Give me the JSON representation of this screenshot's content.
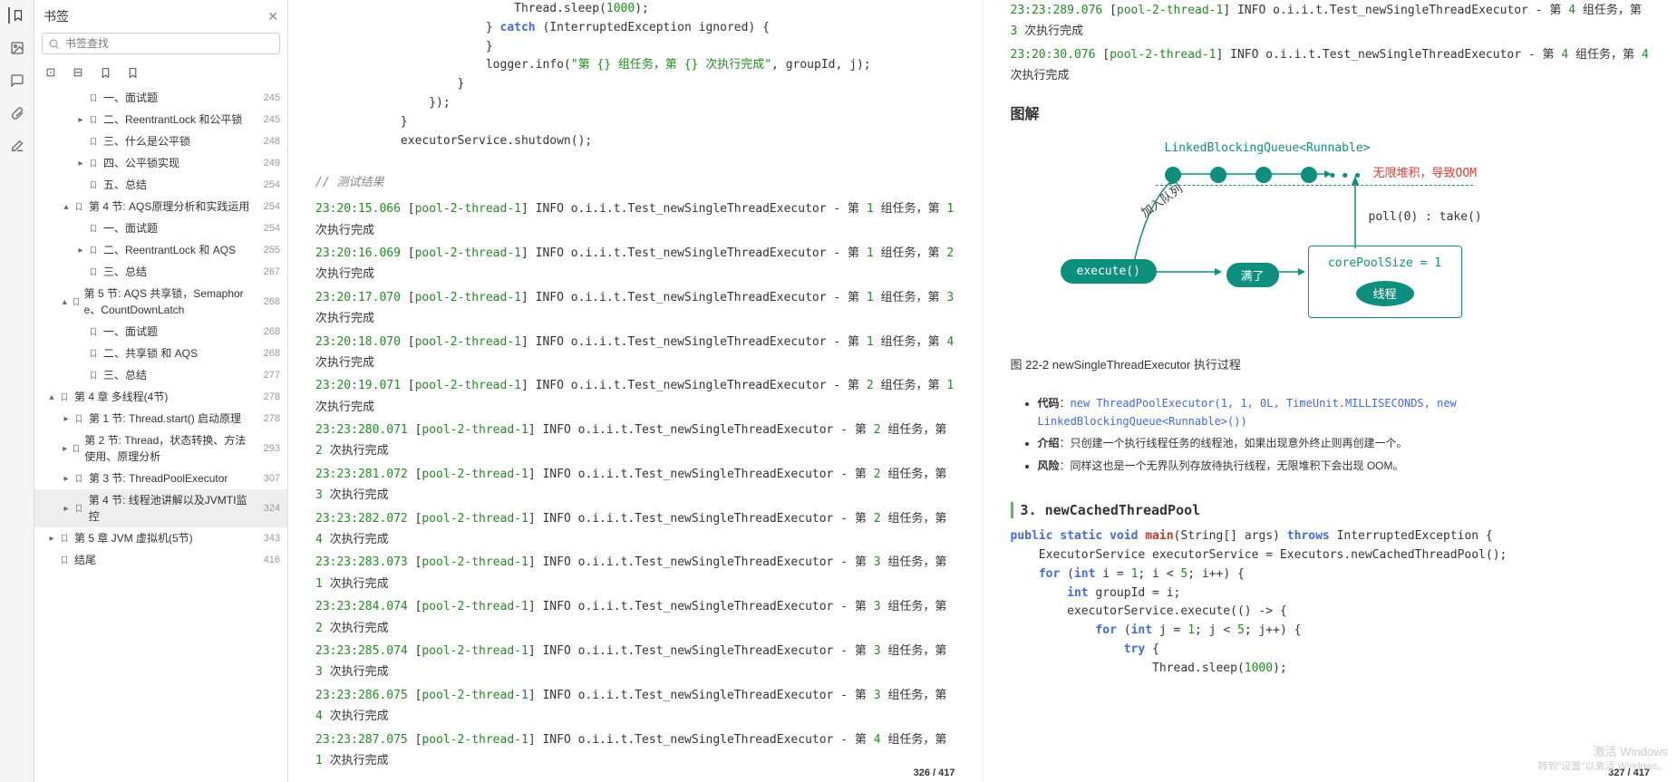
{
  "sidebar": {
    "title": "书签",
    "search_placeholder": "书签查找",
    "items": [
      {
        "arr": "",
        "ind": 2,
        "label": "一、面试题",
        "page": "245"
      },
      {
        "arr": "▸",
        "ind": 2,
        "label": "二、ReentrantLock 和公平锁",
        "page": "245"
      },
      {
        "arr": "",
        "ind": 2,
        "label": "三、什么是公平锁",
        "page": "248"
      },
      {
        "arr": "▸",
        "ind": 2,
        "label": "四、公平锁实现",
        "page": "249"
      },
      {
        "arr": "",
        "ind": 2,
        "label": "五、总结",
        "page": "254"
      },
      {
        "arr": "▴",
        "ind": 1,
        "label": "第 4 节: AQS原理分析和实践运用",
        "page": "254"
      },
      {
        "arr": "",
        "ind": 2,
        "label": "一、面试题",
        "page": "254"
      },
      {
        "arr": "▸",
        "ind": 2,
        "label": "二、ReentrantLock 和 AQS",
        "page": "255"
      },
      {
        "arr": "",
        "ind": 2,
        "label": "三、总结",
        "page": "267"
      },
      {
        "arr": "▴",
        "ind": 1,
        "label": "第 5 节: AQS 共享锁，Semaphore、CountDownLatch",
        "page": "268"
      },
      {
        "arr": "",
        "ind": 2,
        "label": "一、面试题",
        "page": "268"
      },
      {
        "arr": "",
        "ind": 2,
        "label": "二、共享锁 和 AQS",
        "page": "268"
      },
      {
        "arr": "",
        "ind": 2,
        "label": "三、总结",
        "page": "277"
      },
      {
        "arr": "▴",
        "ind": 0,
        "label": "第 4 章 多线程(4节)",
        "page": "278"
      },
      {
        "arr": "▸",
        "ind": 1,
        "label": "第 1 节: Thread.start() 启动原理",
        "page": "278"
      },
      {
        "arr": "▸",
        "ind": 1,
        "label": "第 2 节: Thread，状态转换、方法使用、原理分析",
        "page": "293"
      },
      {
        "arr": "▸",
        "ind": 1,
        "label": "第 3 节: ThreadPoolExecutor",
        "page": "307"
      },
      {
        "arr": "▸",
        "ind": 1,
        "label": "第 4 节: 线程池讲解以及JVMTI监控",
        "page": "324",
        "sel": true
      },
      {
        "arr": "▸",
        "ind": 0,
        "label": "第 5 章 JVM 虚拟机(5节)",
        "page": "343"
      },
      {
        "arr": "",
        "ind": 0,
        "label": "结尾",
        "page": "416"
      }
    ]
  },
  "left_page": {
    "code": [
      "                Thread.sleep(1000);",
      "            } catch (InterruptedException ignored) {",
      "            }",
      "            logger.info(\"第 {} 组任务，第 {} 次执行完成\", groupId, j);",
      "        }",
      "    });",
      "}",
      "executorService.shutdown();"
    ],
    "comment": "// 测试结果",
    "logs": [
      {
        "ts": "23:20:15.066",
        "th": "pool-2-thread-1",
        "g": "1",
        "j": "1"
      },
      {
        "ts": "23:20:16.069",
        "th": "pool-2-thread-1",
        "g": "1",
        "j": "2"
      },
      {
        "ts": "23:20:17.070",
        "th": "pool-2-thread-1",
        "g": "1",
        "j": "3"
      },
      {
        "ts": "23:20:18.070",
        "th": "pool-2-thread-1",
        "g": "1",
        "j": "4"
      },
      {
        "ts": "23:20:19.071",
        "th": "pool-2-thread-1",
        "g": "2",
        "j": "1"
      },
      {
        "ts": "23:23:280.071",
        "th": "pool-2-thread-1",
        "g": "2",
        "j": "2"
      },
      {
        "ts": "23:23:281.072",
        "th": "pool-2-thread-1",
        "g": "2",
        "j": "3"
      },
      {
        "ts": "23:23:282.072",
        "th": "pool-2-thread-1",
        "g": "2",
        "j": "4"
      },
      {
        "ts": "23:23:283.073",
        "th": "pool-2-thread-1",
        "g": "3",
        "j": "1"
      },
      {
        "ts": "23:23:284.074",
        "th": "pool-2-thread-1",
        "g": "3",
        "j": "2"
      },
      {
        "ts": "23:23:285.074",
        "th": "pool-2-thread-1",
        "g": "3",
        "j": "3"
      },
      {
        "ts": "23:23:286.075",
        "th": "pool-2-thread-1",
        "g": "3",
        "j": "4"
      },
      {
        "ts": "23:23:287.075",
        "th": "pool-2-thread-1",
        "g": "4",
        "j": "1"
      }
    ],
    "foot": "326 / 417"
  },
  "right_page": {
    "top_logs": [
      {
        "ts": "23:23:289.076",
        "th": "pool-2-thread-1",
        "g": "4",
        "j": "3"
      },
      {
        "ts": "23:20:30.076",
        "th": "pool-2-thread-1",
        "g": "4",
        "j": "4"
      }
    ],
    "h2": "图解",
    "diagram": {
      "queue_label": "LinkedBlockingQueue<Runnable>",
      "overflow": "无限堆积，导致OOM",
      "enqueue": "加入队列",
      "poll": "poll(0) : take()",
      "execute": "execute()",
      "full": "满了",
      "core": "corePoolSize = 1",
      "thread": "线程"
    },
    "caption": "图 22-2 newSingleThreadExecutor 执行过程",
    "bullets": {
      "b1_label": "代码",
      "b1_code": "new ThreadPoolExecutor(1, 1, 0L, TimeUnit.MILLISECONDS, new LinkedBlockingQueue<Runnable>())",
      "b2_label": "介绍",
      "b2_text": "：只创建一个执行线程任务的线程池，如果出现意外终止则再创建一个。",
      "b3_label": "风险",
      "b3_text": "：同样这也是一个无界队列存放待执行线程，无限堆积下会出现 OOM。"
    },
    "h3": "3. newCachedThreadPool",
    "code2": [
      "public static void main(String[] args) throws InterruptedException {",
      "    ExecutorService executorService = Executors.newCachedThreadPool();",
      "    for (int i = 1; i < 5; i++) {",
      "        int groupId = i;",
      "        executorService.execute(() -> {",
      "            for (int j = 1; j < 5; j++) {",
      "                try {",
      "                    Thread.sleep(1000);"
    ],
    "foot": "327 / 417"
  },
  "watermark": {
    "l1": "激活 Windows",
    "l2": "转到\"设置\"以激活 Windows。"
  }
}
